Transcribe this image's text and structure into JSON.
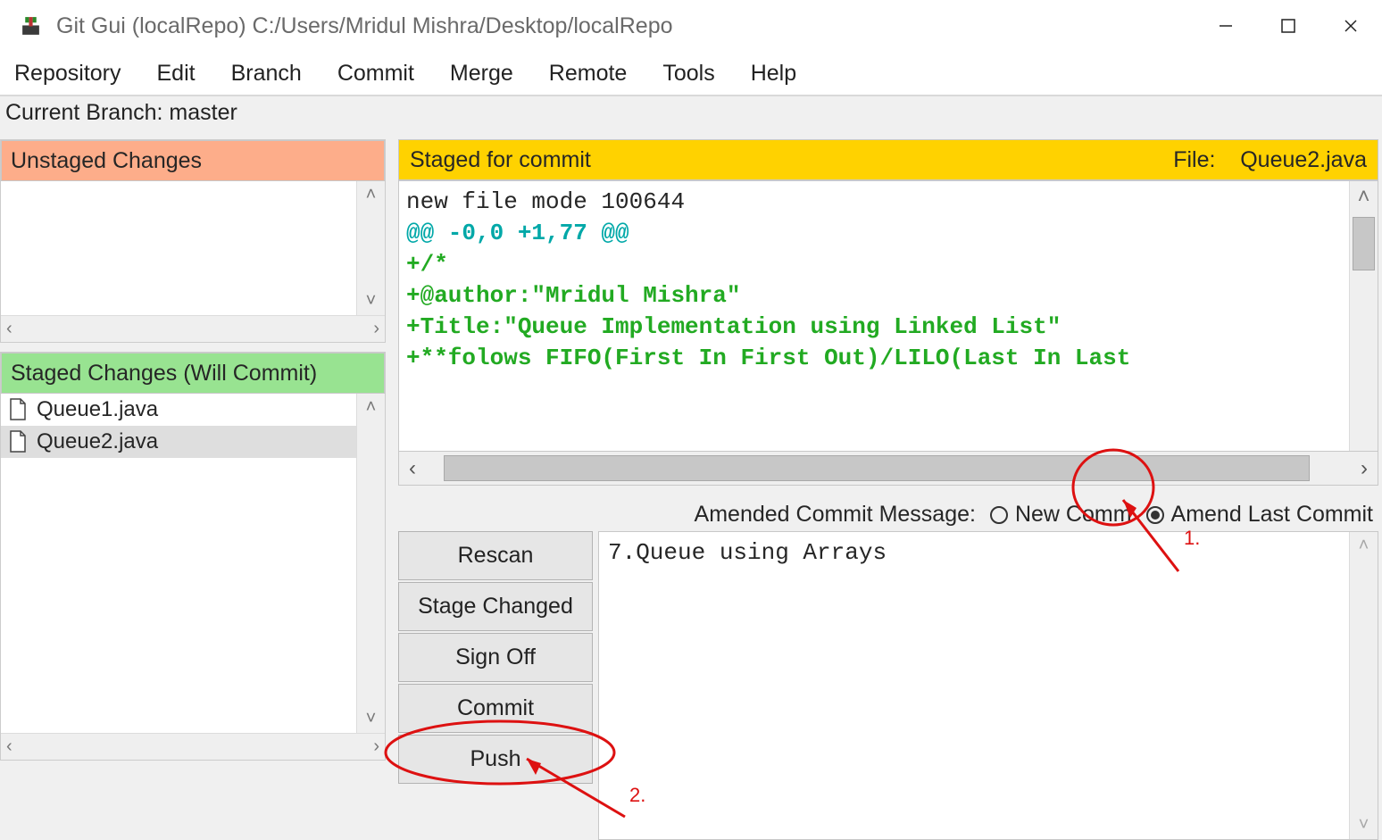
{
  "window": {
    "title": "Git Gui (localRepo) C:/Users/Mridul Mishra/Desktop/localRepo"
  },
  "menus": {
    "repository": "Repository",
    "edit": "Edit",
    "branch": "Branch",
    "commit": "Commit",
    "merge": "Merge",
    "remote": "Remote",
    "tools": "Tools",
    "help": "Help"
  },
  "branch_line": "Current Branch: master",
  "panels": {
    "unstaged_title": "Unstaged Changes",
    "staged_changes_title": "Staged Changes (Will Commit)",
    "staged_for_commit_title": "Staged for commit",
    "file_label": "File:",
    "current_file": "Queue2.java"
  },
  "staged_files": {
    "f0": "Queue1.java",
    "f1": "Queue2.java"
  },
  "diff": {
    "l0": "new file mode 100644",
    "l1": "@@ -0,0 +1,77 @@",
    "l2": "+/*",
    "l3": "+@author:\"Mridul Mishra\"",
    "l4": "+Title:\"Queue Implementation using Linked List\"",
    "l5": "+**folows FIFO(First In First Out)/LILO(Last In Last"
  },
  "commit": {
    "heading": "Amended Commit Message:",
    "radio_new": "New Commit",
    "radio_amend": "Amend Last Commit",
    "message": "7.Queue using Arrays"
  },
  "buttons": {
    "rescan": "Rescan",
    "stage": "Stage Changed",
    "signoff": "Sign Off",
    "commit": "Commit",
    "push": "Push"
  },
  "annotations": {
    "one": "1.",
    "two": "2."
  }
}
